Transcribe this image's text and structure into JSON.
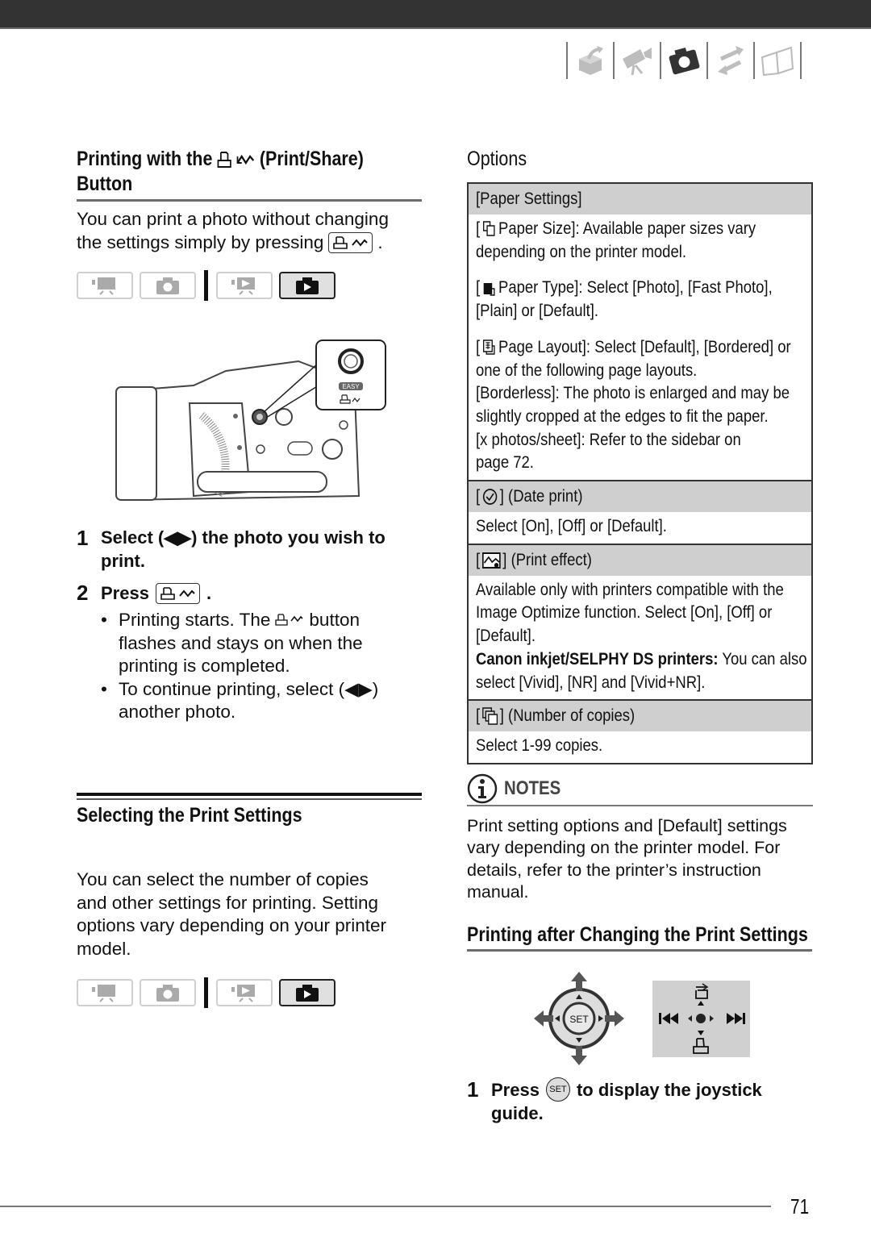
{
  "header": {
    "chapter_icons": [
      {
        "name": "introduction-icon",
        "active": false
      },
      {
        "name": "movies-icon",
        "active": false
      },
      {
        "name": "photos-icon",
        "active": true
      },
      {
        "name": "external-connections-icon",
        "active": false
      },
      {
        "name": "additional-information-icon",
        "active": false
      }
    ]
  },
  "left": {
    "section1": {
      "title_part1": "Printing with the",
      "title_part2": "(Print/Share)",
      "title_line2": "Button",
      "intro_line1": "You can print a photo without changing",
      "intro_line2": "the settings simply by pressing",
      "intro_end": ".",
      "modes": [
        "movie-record-mode",
        "photo-record-mode",
        "movie-playback-mode",
        "photo-playback-mode"
      ],
      "active_mode": "photo-playback-mode",
      "camera_label": "EASY",
      "steps": [
        {
          "num": "1",
          "line1": "Select (◀▶) the photo you wish to",
          "line2": "print."
        },
        {
          "num": "2",
          "text": "Press",
          "end": "."
        }
      ],
      "bullets": [
        {
          "line1_a": "Printing starts. The",
          "line1_b": "button",
          "line2": "flashes and stays on when the",
          "line3": "printing is completed."
        },
        {
          "line1": "To continue printing, select (◀▶)",
          "line2": "another photo."
        }
      ]
    },
    "section2": {
      "title": "Selecting the Print Settings",
      "lines": [
        "You can select the number of copies",
        "and other settings for printing. Setting",
        "options vary depending on your printer",
        "model."
      ],
      "modes": [
        "movie-record-mode",
        "photo-record-mode",
        "movie-playback-mode",
        "photo-playback-mode"
      ],
      "active_mode": "photo-playback-mode"
    }
  },
  "right": {
    "options_title": "Options",
    "table": {
      "paper_settings_header": "[Paper Settings]",
      "paper_size": {
        "open": "[",
        "line1": "Paper Size]: Available paper sizes vary",
        "line2": "depending on the printer model."
      },
      "paper_type": {
        "open": "[",
        "line1": "Paper Type]: Select [Photo], [Fast Photo],",
        "line2": "[Plain] or [Default]."
      },
      "page_layout": {
        "open": "[",
        "line1": "Page Layout]: Select [Default], [Bordered] or",
        "lines": [
          "one of the following page layouts.",
          "[Borderless]: The photo is enlarged and may be",
          "slightly cropped at the edges to fit the paper.",
          "[x photos/sheet]: Refer to the sidebar on",
          "page 72."
        ]
      },
      "date_print_header": {
        "open": "[",
        "close": "] (Date print)"
      },
      "date_print_body": "Select [On], [Off] or [Default].",
      "print_effect_header": {
        "open": "[",
        "close": "] (Print effect)"
      },
      "print_effect_body": [
        "Available only with printers compatible with the",
        "Image Optimize function. Select [On], [Off] or",
        "[Default]."
      ],
      "print_effect_bold": "Canon inkjet/SELPHY DS printers:",
      "print_effect_tail": " You can also",
      "print_effect_last": "select [Vivid], [NR] and [Vivid+NR].",
      "copies_header": {
        "open": "[",
        "close": "] (Number of copies)"
      },
      "copies_body": "Select 1-99 copies."
    },
    "notes": {
      "label": "NOTES",
      "lines": [
        "Print setting options and [Default] settings",
        "vary depending on the printer model. For",
        "details, refer to the printer’s instruction",
        "manual."
      ]
    },
    "section3": {
      "title": "Printing after Changing the Print Settings",
      "joystick_center": "SET",
      "step": {
        "num": "1",
        "text_a": "Press",
        "button": "SET",
        "text_b": "to display the joystick",
        "line2": "guide."
      }
    }
  },
  "footer": {
    "page_number": "71"
  }
}
